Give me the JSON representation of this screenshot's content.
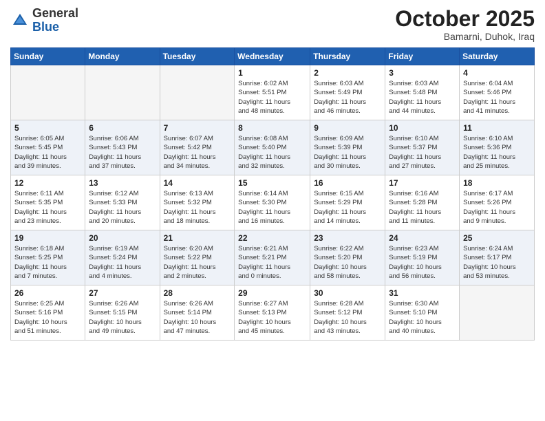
{
  "header": {
    "logo_general": "General",
    "logo_blue": "Blue",
    "month_title": "October 2025",
    "location": "Bamarni, Duhok, Iraq"
  },
  "weekdays": [
    "Sunday",
    "Monday",
    "Tuesday",
    "Wednesday",
    "Thursday",
    "Friday",
    "Saturday"
  ],
  "weeks": [
    [
      {
        "day": "",
        "info": ""
      },
      {
        "day": "",
        "info": ""
      },
      {
        "day": "",
        "info": ""
      },
      {
        "day": "1",
        "info": "Sunrise: 6:02 AM\nSunset: 5:51 PM\nDaylight: 11 hours\nand 48 minutes."
      },
      {
        "day": "2",
        "info": "Sunrise: 6:03 AM\nSunset: 5:49 PM\nDaylight: 11 hours\nand 46 minutes."
      },
      {
        "day": "3",
        "info": "Sunrise: 6:03 AM\nSunset: 5:48 PM\nDaylight: 11 hours\nand 44 minutes."
      },
      {
        "day": "4",
        "info": "Sunrise: 6:04 AM\nSunset: 5:46 PM\nDaylight: 11 hours\nand 41 minutes."
      }
    ],
    [
      {
        "day": "5",
        "info": "Sunrise: 6:05 AM\nSunset: 5:45 PM\nDaylight: 11 hours\nand 39 minutes."
      },
      {
        "day": "6",
        "info": "Sunrise: 6:06 AM\nSunset: 5:43 PM\nDaylight: 11 hours\nand 37 minutes."
      },
      {
        "day": "7",
        "info": "Sunrise: 6:07 AM\nSunset: 5:42 PM\nDaylight: 11 hours\nand 34 minutes."
      },
      {
        "day": "8",
        "info": "Sunrise: 6:08 AM\nSunset: 5:40 PM\nDaylight: 11 hours\nand 32 minutes."
      },
      {
        "day": "9",
        "info": "Sunrise: 6:09 AM\nSunset: 5:39 PM\nDaylight: 11 hours\nand 30 minutes."
      },
      {
        "day": "10",
        "info": "Sunrise: 6:10 AM\nSunset: 5:37 PM\nDaylight: 11 hours\nand 27 minutes."
      },
      {
        "day": "11",
        "info": "Sunrise: 6:10 AM\nSunset: 5:36 PM\nDaylight: 11 hours\nand 25 minutes."
      }
    ],
    [
      {
        "day": "12",
        "info": "Sunrise: 6:11 AM\nSunset: 5:35 PM\nDaylight: 11 hours\nand 23 minutes."
      },
      {
        "day": "13",
        "info": "Sunrise: 6:12 AM\nSunset: 5:33 PM\nDaylight: 11 hours\nand 20 minutes."
      },
      {
        "day": "14",
        "info": "Sunrise: 6:13 AM\nSunset: 5:32 PM\nDaylight: 11 hours\nand 18 minutes."
      },
      {
        "day": "15",
        "info": "Sunrise: 6:14 AM\nSunset: 5:30 PM\nDaylight: 11 hours\nand 16 minutes."
      },
      {
        "day": "16",
        "info": "Sunrise: 6:15 AM\nSunset: 5:29 PM\nDaylight: 11 hours\nand 14 minutes."
      },
      {
        "day": "17",
        "info": "Sunrise: 6:16 AM\nSunset: 5:28 PM\nDaylight: 11 hours\nand 11 minutes."
      },
      {
        "day": "18",
        "info": "Sunrise: 6:17 AM\nSunset: 5:26 PM\nDaylight: 11 hours\nand 9 minutes."
      }
    ],
    [
      {
        "day": "19",
        "info": "Sunrise: 6:18 AM\nSunset: 5:25 PM\nDaylight: 11 hours\nand 7 minutes."
      },
      {
        "day": "20",
        "info": "Sunrise: 6:19 AM\nSunset: 5:24 PM\nDaylight: 11 hours\nand 4 minutes."
      },
      {
        "day": "21",
        "info": "Sunrise: 6:20 AM\nSunset: 5:22 PM\nDaylight: 11 hours\nand 2 minutes."
      },
      {
        "day": "22",
        "info": "Sunrise: 6:21 AM\nSunset: 5:21 PM\nDaylight: 11 hours\nand 0 minutes."
      },
      {
        "day": "23",
        "info": "Sunrise: 6:22 AM\nSunset: 5:20 PM\nDaylight: 10 hours\nand 58 minutes."
      },
      {
        "day": "24",
        "info": "Sunrise: 6:23 AM\nSunset: 5:19 PM\nDaylight: 10 hours\nand 56 minutes."
      },
      {
        "day": "25",
        "info": "Sunrise: 6:24 AM\nSunset: 5:17 PM\nDaylight: 10 hours\nand 53 minutes."
      }
    ],
    [
      {
        "day": "26",
        "info": "Sunrise: 6:25 AM\nSunset: 5:16 PM\nDaylight: 10 hours\nand 51 minutes."
      },
      {
        "day": "27",
        "info": "Sunrise: 6:26 AM\nSunset: 5:15 PM\nDaylight: 10 hours\nand 49 minutes."
      },
      {
        "day": "28",
        "info": "Sunrise: 6:26 AM\nSunset: 5:14 PM\nDaylight: 10 hours\nand 47 minutes."
      },
      {
        "day": "29",
        "info": "Sunrise: 6:27 AM\nSunset: 5:13 PM\nDaylight: 10 hours\nand 45 minutes."
      },
      {
        "day": "30",
        "info": "Sunrise: 6:28 AM\nSunset: 5:12 PM\nDaylight: 10 hours\nand 43 minutes."
      },
      {
        "day": "31",
        "info": "Sunrise: 6:30 AM\nSunset: 5:10 PM\nDaylight: 10 hours\nand 40 minutes."
      },
      {
        "day": "",
        "info": ""
      }
    ]
  ]
}
